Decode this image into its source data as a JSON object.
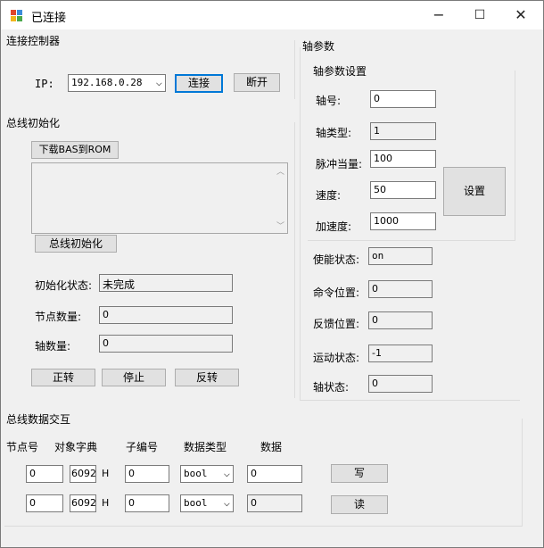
{
  "window": {
    "title": "已连接",
    "minimize": "−",
    "maximize": "☐",
    "close": "✕"
  },
  "connect": {
    "group_label": "连接控制器",
    "ip_label": "IP:",
    "ip_value": "192.168.0.28",
    "connect_button": "连接",
    "disconnect_button": "断开"
  },
  "bus_init": {
    "group_label": "总线初始化",
    "download_button": "下载BAS到ROM",
    "init_button": "总线初始化",
    "init_status_label": "初始化状态:",
    "init_status_value": "未完成",
    "node_count_label": "节点数量:",
    "node_count_value": "0",
    "axis_count_label": "轴数量:",
    "axis_count_value": "0",
    "forward_button": "正转",
    "stop_button": "停止",
    "reverse_button": "反转"
  },
  "axis": {
    "group_label": "轴参数",
    "settings_group_label": "轴参数设置",
    "axis_no_label": "轴号:",
    "axis_no_value": "0",
    "axis_type_label": "轴类型:",
    "axis_type_value": "1",
    "pulse_label": "脉冲当量:",
    "pulse_value": "100",
    "speed_label": "速度:",
    "speed_value": "50",
    "accel_label": "加速度:",
    "accel_value": "1000",
    "set_button": "设置",
    "enable_label": "使能状态:",
    "enable_value": "on",
    "cmd_pos_label": "命令位置:",
    "cmd_pos_value": "0",
    "fb_pos_label": "反馈位置:",
    "fb_pos_value": "0",
    "motion_label": "运动状态:",
    "motion_value": "-1",
    "axis_state_label": "轴状态:",
    "axis_state_value": "0"
  },
  "bus_data": {
    "group_label": "总线数据交互",
    "headers": [
      "节点号",
      "对象字典",
      "子编号",
      "数据类型",
      "数据"
    ],
    "rows": [
      {
        "node": "0",
        "index": "6092",
        "hex": "H",
        "sub": "0",
        "type": "bool",
        "data": "0",
        "button": "写"
      },
      {
        "node": "0",
        "index": "6092",
        "hex": "H",
        "sub": "0",
        "type": "bool",
        "data": "0",
        "button": "读"
      }
    ]
  }
}
